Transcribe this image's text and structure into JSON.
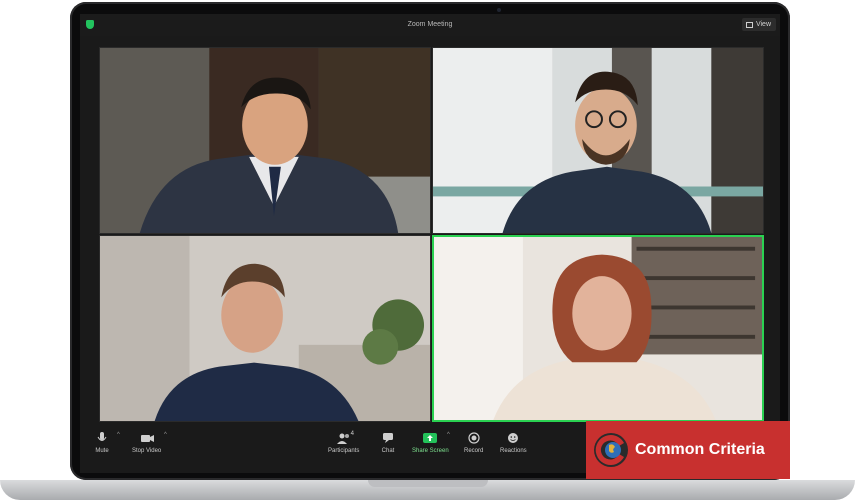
{
  "window": {
    "title": "Zoom Meeting",
    "view_label": "View"
  },
  "participants_count": "4",
  "toolbar": {
    "mute": "Mute",
    "stop_video": "Stop Video",
    "participants": "Participants",
    "chat": "Chat",
    "share_screen": "Share Screen",
    "record": "Record",
    "reactions": "Reactions"
  },
  "brand": {
    "text": "Common Criteria"
  },
  "colors": {
    "accent_green": "#2ad151",
    "share_green": "#23c25a",
    "brand_red": "#c8302f"
  },
  "icons": [
    "shield-icon",
    "grid-icon",
    "microphone-icon",
    "video-camera-icon",
    "participants-icon",
    "chat-icon",
    "share-screen-icon",
    "record-icon",
    "reactions-icon",
    "globe-logo"
  ]
}
